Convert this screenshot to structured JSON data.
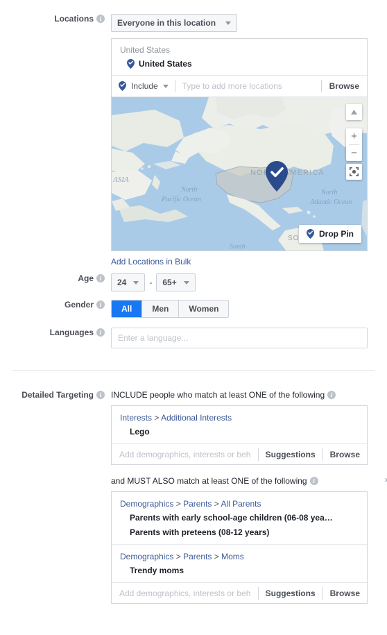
{
  "colors": {
    "accent_blue": "#1877f2",
    "link_blue": "#3b5998",
    "pin_blue": "#365899",
    "ocean": "#aacbe8",
    "land": "#f2f2f0",
    "border": "#d3d6db",
    "muted_text": "#90949c"
  },
  "locations": {
    "label": "Locations",
    "info": "i",
    "type_select": "Everyone in this location",
    "group_header": "United States",
    "selected_entry": "United States",
    "include_label": "Include",
    "input_placeholder": "Type to add more locations",
    "input_value": "",
    "browse_label": "Browse",
    "bulk_link": "Add Locations in Bulk",
    "map": {
      "drop_pin_label": "Drop Pin",
      "zoom_in": "+",
      "zoom_out": "−",
      "labels": [
        "ASIA",
        "NORTH AMERICA",
        "North Pacific Ocean",
        "North Atlantic Ocean",
        "SOUTH AMERICA",
        "South"
      ]
    }
  },
  "age": {
    "label": "Age",
    "info": "i",
    "min": "24",
    "max": "65+",
    "separator": "-"
  },
  "gender": {
    "label": "Gender",
    "info": "i",
    "options": [
      "All",
      "Men",
      "Women"
    ],
    "selected": "All"
  },
  "languages": {
    "label": "Languages",
    "info": "i",
    "placeholder": "Enter a language...",
    "value": ""
  },
  "detailed_targeting": {
    "label": "Detailed Targeting",
    "info": "i",
    "blocks": [
      {
        "heading": "INCLUDE people who match at least ONE of the following",
        "info": "i",
        "closable": false,
        "close_label": "×",
        "groups": [
          {
            "crumbs": [
              "Interests",
              "Additional Interests"
            ],
            "items": [
              "Lego"
            ]
          }
        ],
        "input_placeholder": "Add demographics, interests or beha...",
        "input_value": "",
        "suggestions_label": "Suggestions",
        "browse_label": "Browse"
      },
      {
        "heading": "and MUST ALSO match at least ONE of the following",
        "info": "i",
        "closable": true,
        "close_label": "×",
        "groups": [
          {
            "crumbs": [
              "Demographics",
              "Parents",
              "All Parents"
            ],
            "items": [
              "Parents with early school-age children (06-08 yea…",
              "Parents with preteens (08-12 years)"
            ]
          },
          {
            "crumbs": [
              "Demographics",
              "Parents",
              "Moms"
            ],
            "items": [
              "Trendy moms"
            ]
          }
        ],
        "input_placeholder": "Add demographics, interests or beha...",
        "input_value": "",
        "suggestions_label": "Suggestions",
        "browse_label": "Browse"
      }
    ]
  }
}
